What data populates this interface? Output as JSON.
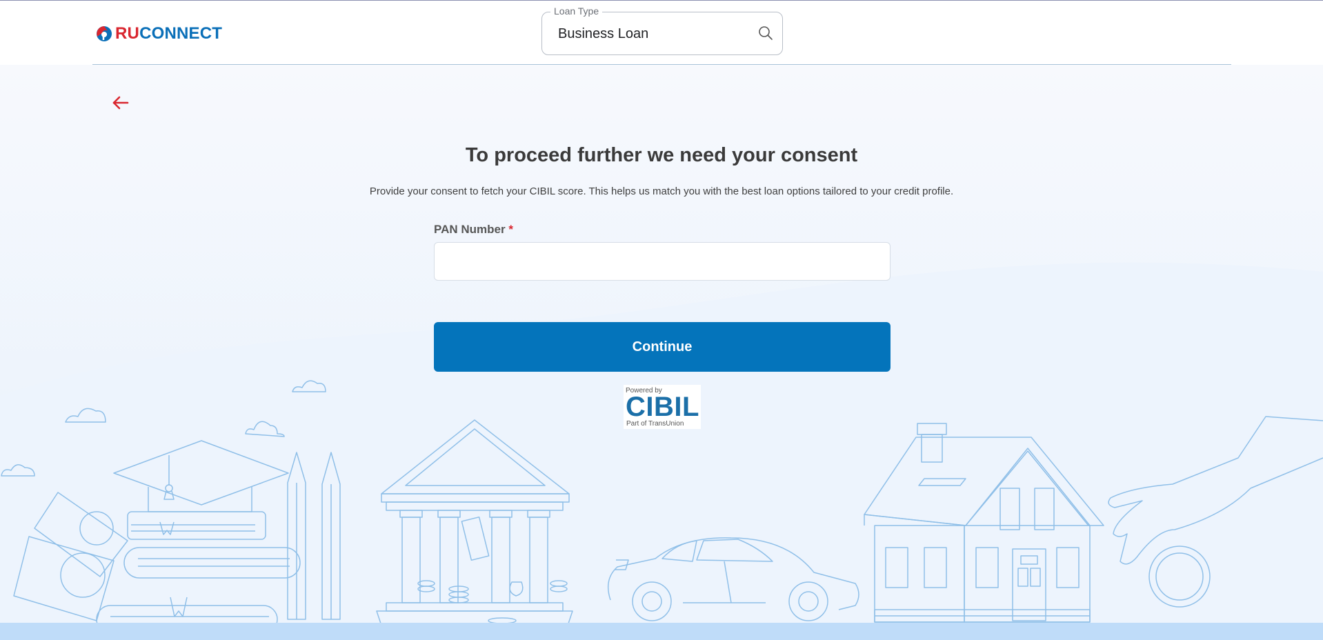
{
  "brand": {
    "name_part1": "RU",
    "name_part2": "CONNECT"
  },
  "header": {
    "loan_type_label": "Loan Type",
    "loan_type_value": "Business Loan"
  },
  "consent": {
    "title": "To proceed further we need your consent",
    "subtitle": "Provide your consent to fetch your CIBIL score. This helps us match you with the best loan options tailored to your credit profile.",
    "pan_label": "PAN Number",
    "required_mark": "*",
    "pan_value": "",
    "continue_label": "Continue"
  },
  "cibil_badge": {
    "powered_by": "Powered by",
    "name": "CIBIL",
    "part_of": "Part of TransUnion"
  },
  "icons": {
    "back": "arrow-left-icon",
    "search": "search-icon"
  },
  "colors": {
    "primary": "#0474bb",
    "brand_red": "#d9262f",
    "illustration_stroke": "#8fbfe8"
  }
}
